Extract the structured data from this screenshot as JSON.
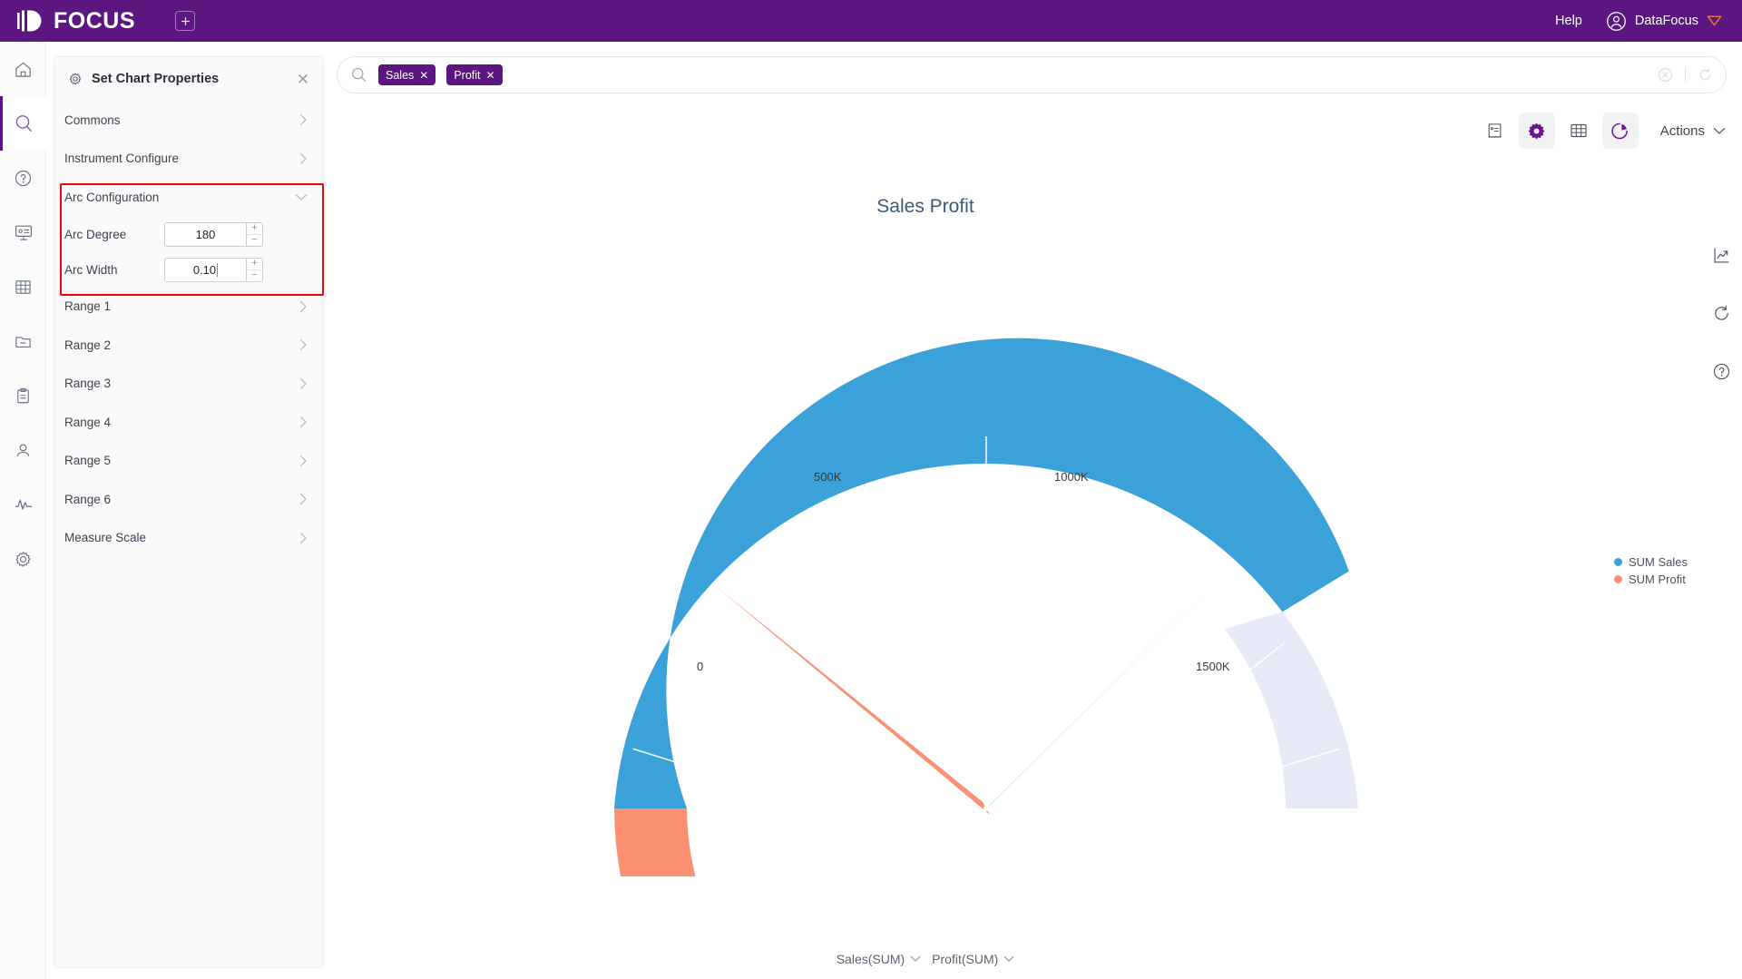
{
  "topbar": {
    "brand": "FOCUS",
    "add_tab_icon": "plus-square-icon",
    "help_label": "Help",
    "user_name": "DataFocus",
    "user_icon": "user-circle-icon",
    "brand_purple": "#5b1680"
  },
  "rail": {
    "items": [
      {
        "name": "home-icon",
        "active": false
      },
      {
        "name": "search-icon",
        "active": true
      },
      {
        "name": "question-circle-icon",
        "active": false
      },
      {
        "name": "presentation-icon",
        "active": false
      },
      {
        "name": "table-grid-icon",
        "active": false
      },
      {
        "name": "folder-icon",
        "active": false
      },
      {
        "name": "clipboard-icon",
        "active": false
      },
      {
        "name": "user-icon",
        "active": false
      },
      {
        "name": "pulse-icon",
        "active": false
      },
      {
        "name": "gear-icon",
        "active": false
      }
    ]
  },
  "panel": {
    "title": "Set Chart Properties",
    "title_icon": "gear-icon",
    "close_icon": "close-icon",
    "rows_top": [
      {
        "label": "Commons"
      },
      {
        "label": "Instrument Configure"
      }
    ],
    "arc_section": {
      "label": "Arc Configuration",
      "expanded": true,
      "fields": [
        {
          "label": "Arc Degree",
          "value": "180",
          "has_caret": false
        },
        {
          "label": "Arc Width",
          "value": "0.10",
          "has_caret": true
        }
      ],
      "highlight_color": "#fb0007"
    },
    "rows_bottom": [
      {
        "label": "Range 1"
      },
      {
        "label": "Range 2"
      },
      {
        "label": "Range 3"
      },
      {
        "label": "Range 4"
      },
      {
        "label": "Range 5"
      },
      {
        "label": "Range 6"
      },
      {
        "label": "Measure Scale"
      }
    ]
  },
  "search": {
    "icon": "search-icon",
    "chips": [
      {
        "label": "Sales",
        "remove_icon": "close-icon"
      },
      {
        "label": "Profit",
        "remove_icon": "close-icon"
      }
    ],
    "clear_icon": "clear-circle-icon",
    "refresh_icon": "refresh-icon"
  },
  "chart_toolbar": {
    "buttons": [
      {
        "name": "receipt-icon",
        "active": false
      },
      {
        "name": "gear-icon",
        "active": true
      },
      {
        "name": "table-icon",
        "active": false
      },
      {
        "name": "pie-chart-icon",
        "active": true
      }
    ],
    "actions_label": "Actions",
    "actions_chevron": "chevron-down-icon"
  },
  "right_tools": [
    {
      "name": "trend-chart-icon"
    },
    {
      "name": "refresh-icon"
    },
    {
      "name": "help-circle-icon"
    }
  ],
  "bottom_fields": [
    {
      "label": "Sales(SUM)",
      "chevron": "chevron-down-icon"
    },
    {
      "label": "Profit(SUM)",
      "chevron": "chevron-down-icon"
    }
  ],
  "chart_data": {
    "type": "gauge",
    "title": "Sales Profit",
    "min": 0,
    "max": 1500000,
    "start_angle": 180,
    "end_angle": 0,
    "arc_degree": 180,
    "arc_width": 0.1,
    "tick_labels": [
      "0",
      "500K",
      "1000K",
      "1500K"
    ],
    "tick_values": [
      0,
      500000,
      1000000,
      1500000
    ],
    "major_ticks": 10,
    "axis_label_color": "#3b3b2e",
    "series": [
      {
        "name": "SUM Sales",
        "value": 1060000,
        "color": "#3ba1d9",
        "pct": 0.707
      },
      {
        "name": "SUM Profit",
        "value": 165000,
        "color": "#fb9172",
        "pct": 0.11
      }
    ],
    "bands": [
      {
        "name": "profit-band",
        "from": 0,
        "to": 165000,
        "color": "#fb9172"
      },
      {
        "name": "sales-band",
        "from": 165000,
        "to": 1060000,
        "color": "#3ba1d9"
      },
      {
        "name": "remainder-band",
        "from": 1060000,
        "to": 1500000,
        "color": "#e6ebf7"
      }
    ],
    "legend": [
      {
        "label": "SUM Sales",
        "color": "#3ba1d9"
      },
      {
        "label": "SUM Profit",
        "color": "#fb9172"
      }
    ],
    "legend_position": "right"
  }
}
